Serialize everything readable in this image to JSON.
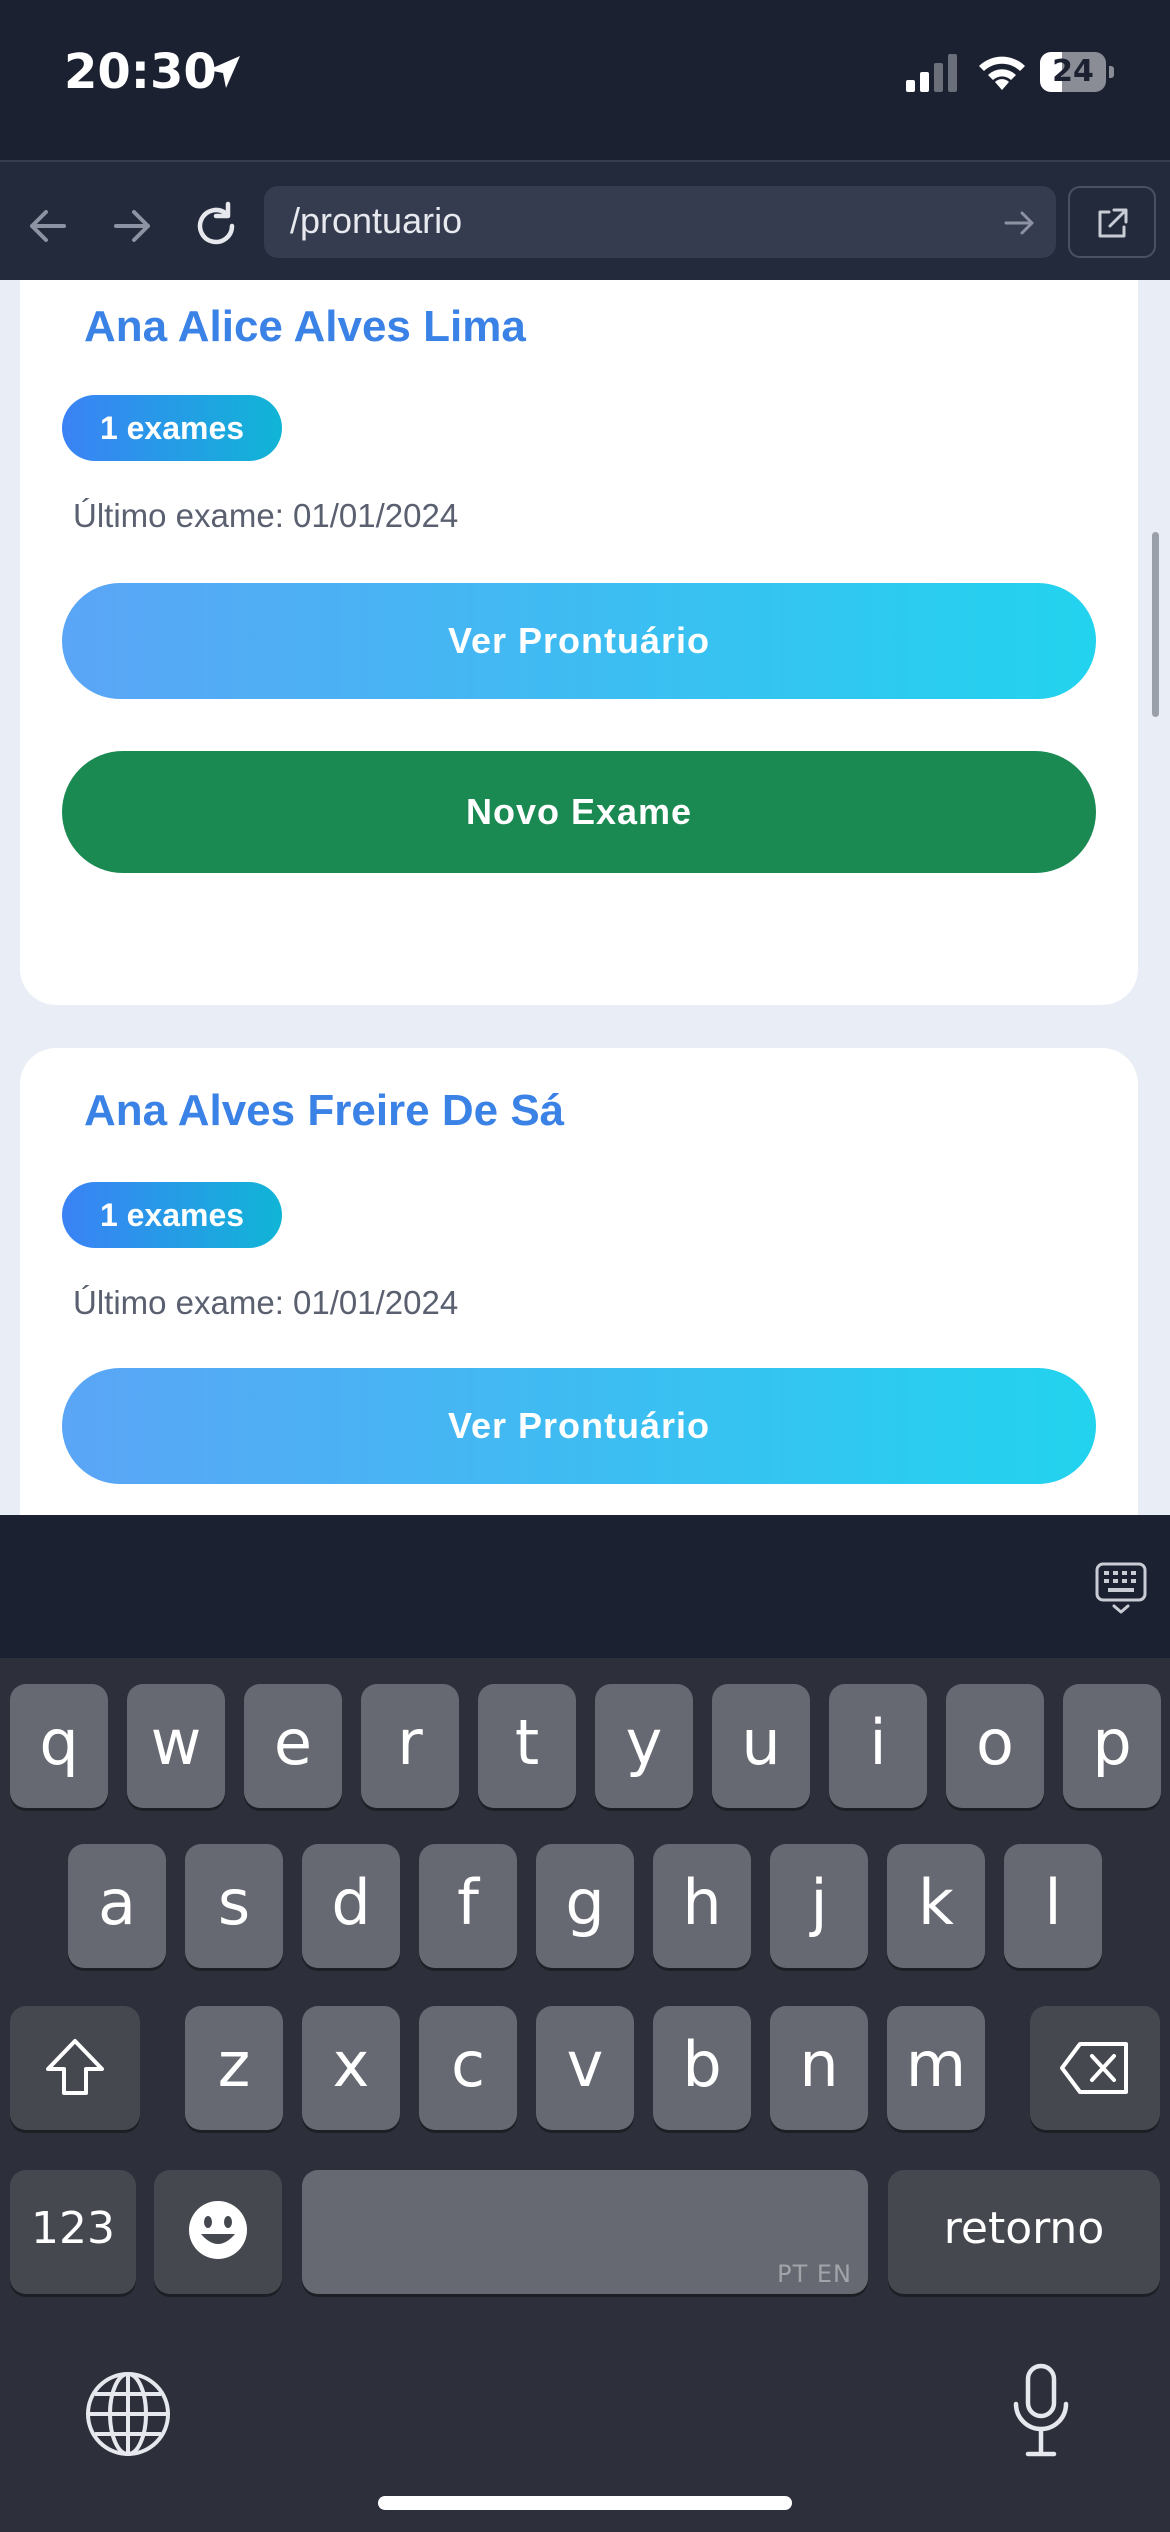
{
  "status_bar": {
    "time": "20:30",
    "battery": "24"
  },
  "browser": {
    "url": "/prontuario"
  },
  "patients": [
    {
      "name": "Ana Alice Alves Lima",
      "exams_badge": "1 exames",
      "last_exam": "Último exame: 01/01/2024",
      "view_label": "Ver Prontuário",
      "new_label": "Novo Exame"
    },
    {
      "name": "Ana Alves Freire De Sá",
      "exams_badge": "1 exames",
      "last_exam": "Último exame: 01/01/2024",
      "view_label": "Ver Prontuário"
    }
  ],
  "keyboard": {
    "row1": [
      "q",
      "w",
      "e",
      "r",
      "t",
      "y",
      "u",
      "i",
      "o",
      "p"
    ],
    "row2": [
      "a",
      "s",
      "d",
      "f",
      "g",
      "h",
      "j",
      "k",
      "l"
    ],
    "row3": [
      "z",
      "x",
      "c",
      "v",
      "b",
      "n",
      "m"
    ],
    "numbers_key": "123",
    "return_key": "retorno",
    "space_languages": "PT EN"
  },
  "colors": {
    "accent": "#3b82e6",
    "green": "#1a8a52",
    "dark_bg": "#1c2131"
  }
}
